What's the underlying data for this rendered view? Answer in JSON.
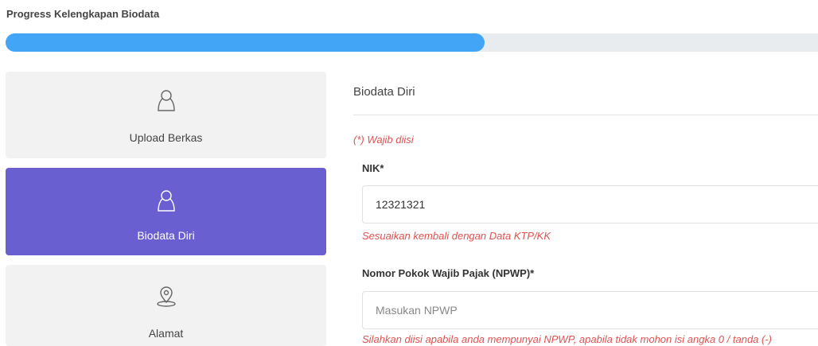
{
  "progress": {
    "title": "Progress Kelengkapan Biodata",
    "percent": 59
  },
  "steps": [
    {
      "label": "Upload Berkas",
      "icon": "user-icon",
      "active": false
    },
    {
      "label": "Biodata Diri",
      "icon": "user-icon",
      "active": true
    },
    {
      "label": "Alamat",
      "icon": "map-pin-icon",
      "active": false
    }
  ],
  "form": {
    "section_title": "Biodata Diri",
    "required_note": "(*) Wajib diisi",
    "nik": {
      "label": "NIK*",
      "value": "12321321",
      "hint": "Sesuaikan kembali dengan Data KTP/KK"
    },
    "npwp": {
      "label": "Nomor Pokok Wajib Pajak (NPWP)*",
      "placeholder": "Masukan NPWP",
      "hint": "Silahkan diisi apabila anda mempunyai NPWP, apabila tidak mohon isi angka 0 / tanda (-)"
    }
  },
  "colors": {
    "accent": "#6a5fd1",
    "progress": "#42a5f5",
    "error": "#e05252"
  }
}
